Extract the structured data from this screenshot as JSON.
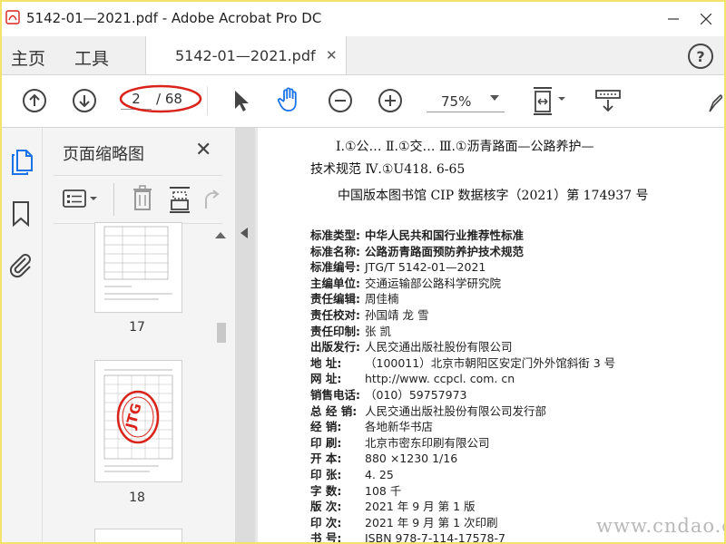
{
  "window": {
    "title": "5142-01—2021.pdf - Adobe Acrobat Pro DC",
    "icon": "acrobat-pdf-icon"
  },
  "tabs": {
    "home": "主页",
    "tools": "工具",
    "file": "5142-01—2021.pdf",
    "help": "?"
  },
  "toolbar": {
    "page_current": "2",
    "page_total": "/ 68",
    "zoom": "75%"
  },
  "thumb_panel": {
    "title": "页面缩略图",
    "pages": [
      {
        "number": "17"
      },
      {
        "number": "18"
      }
    ],
    "stamp_text": "JTG"
  },
  "document": {
    "line1": "Ⅰ.①公…   Ⅱ.①交…   Ⅲ.①沥青路面—公路养护—",
    "line2": "技术规范   Ⅳ.①U418. 6-65",
    "cip": "中国版本图书馆 CIP 数据核字（2021）第 174937 号",
    "meta": [
      {
        "label": "标准类型:",
        "value": "中华人民共和国行业推荐性标准",
        "bold_value": true
      },
      {
        "label": "标准名称:",
        "value": "公路沥青路面预防养护技术规范",
        "bold_value": true
      },
      {
        "label": "标准编号:",
        "value": "JTG/T 5142-01—2021",
        "bold_value": false
      },
      {
        "label": "主编单位:",
        "value": "交通运输部公路科学研究院",
        "bold_value": false
      },
      {
        "label": "责任编辑:",
        "value": "周佳楠",
        "bold_value": false
      },
      {
        "label": "责任校对:",
        "value": "孙国靖   龙   雪",
        "bold_value": false
      },
      {
        "label": "责任印制:",
        "value": "张   凯",
        "bold_value": false
      },
      {
        "label": "出版发行:",
        "value": "人民交通出版社股份有限公司",
        "bold_value": false
      },
      {
        "label": "地      址:",
        "value": "（100011）北京市朝阳区安定门外外馆斜街 3 号",
        "bold_value": false
      },
      {
        "label": "网      址:",
        "value": "http://www. ccpcl. com. cn",
        "bold_value": false
      },
      {
        "label": "销售电话:",
        "value": "（010）59757973",
        "bold_value": false
      },
      {
        "label": "总  经  销:",
        "value": "人民交通出版社股份有限公司发行部",
        "bold_value": false
      },
      {
        "label": "经      销:",
        "value": "各地新华书店",
        "bold_value": false
      },
      {
        "label": "印      刷:",
        "value": "北京市密东印刷有限公司",
        "bold_value": false
      },
      {
        "label": "开      本:",
        "value": "880 ×1230   1/16",
        "bold_value": false
      },
      {
        "label": "印      张:",
        "value": "4. 25",
        "bold_value": false
      },
      {
        "label": "字      数:",
        "value": "108 千",
        "bold_value": false
      },
      {
        "label": "版      次:",
        "value": "2021 年 9 月    第 1 版",
        "bold_value": false
      },
      {
        "label": "印      次:",
        "value": "2021 年 9 月    第 1 次印刷",
        "bold_value": false
      },
      {
        "label": "书      号:",
        "value": "ISBN 978-7-114-17578-7",
        "bold_value": false
      }
    ]
  },
  "watermark": "www.cndao.com",
  "colors": {
    "hand_cursor": "#1a73e8",
    "red_annotation": "#d9241b",
    "frame_border": "#f4e36a"
  }
}
